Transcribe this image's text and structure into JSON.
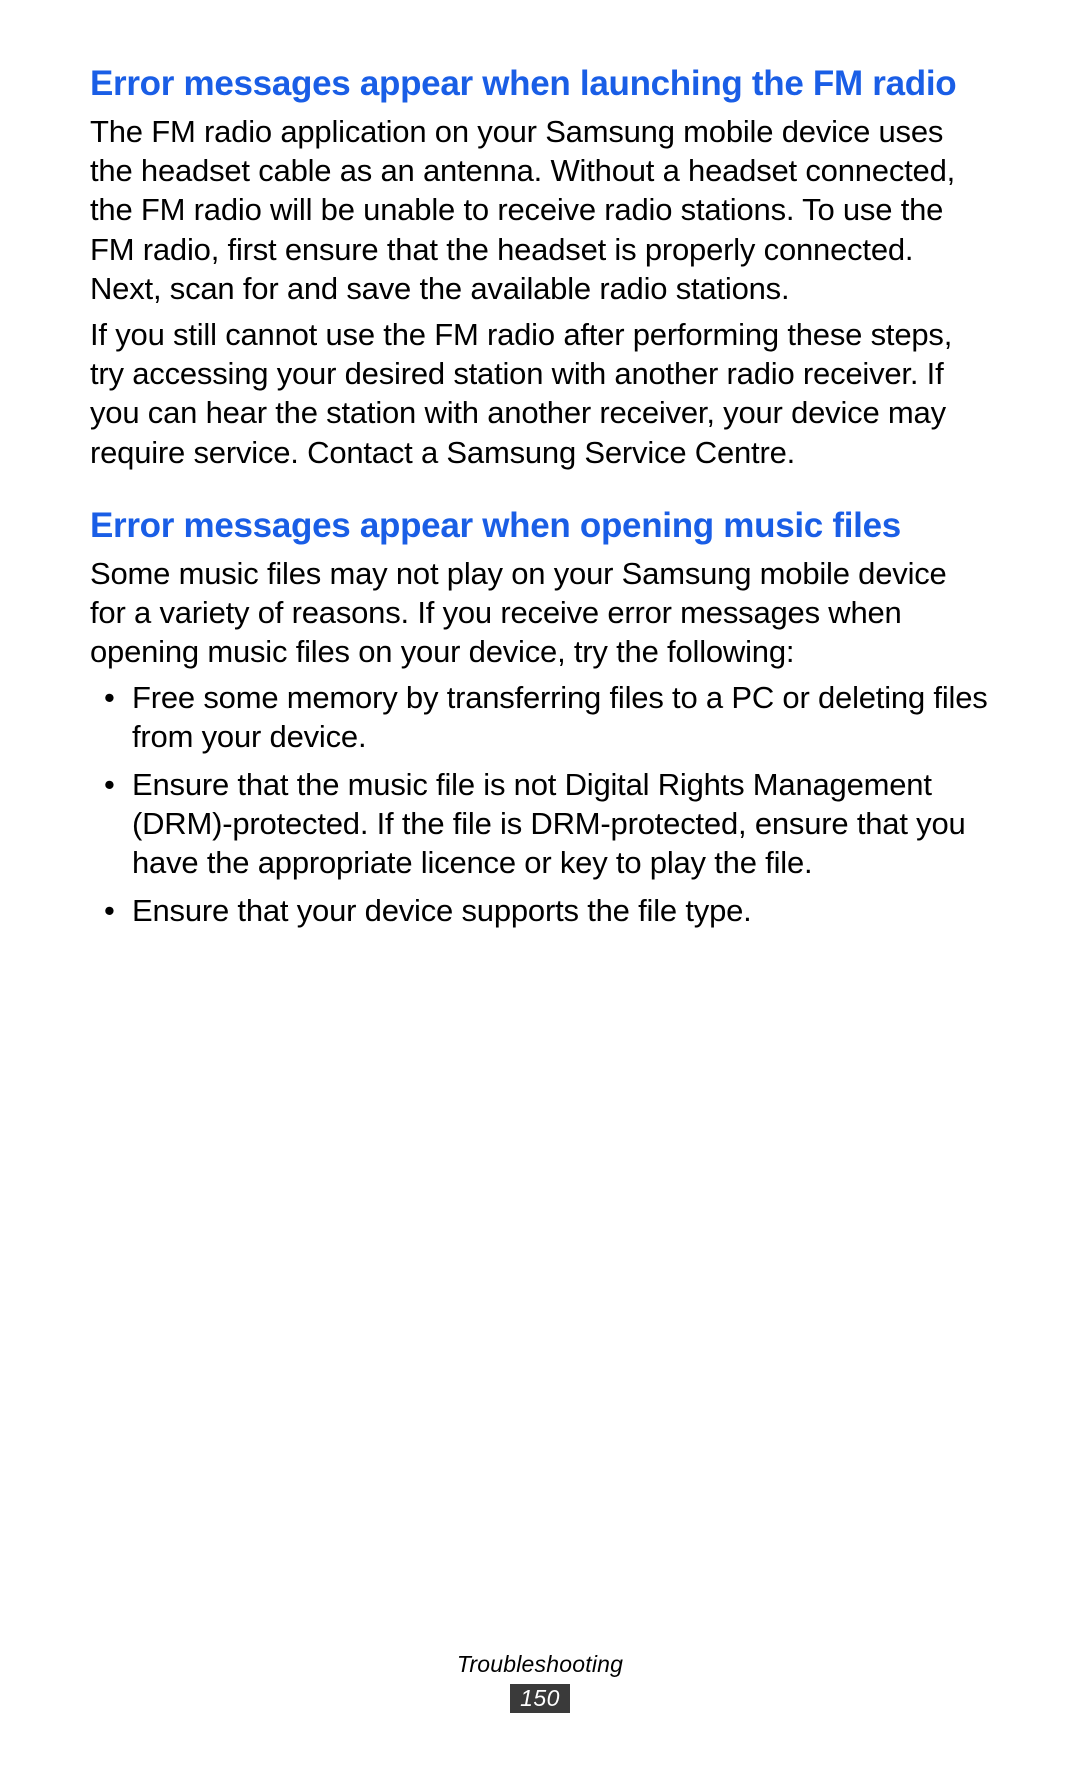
{
  "sections": {
    "fm_radio": {
      "heading": "Error messages appear when launching the FM radio",
      "para1": "The FM radio application on your Samsung mobile device uses the headset cable as an antenna. Without a headset connected, the FM radio will be unable to receive radio stations. To use the FM radio, first ensure that the headset is properly connected. Next, scan for and save the available radio stations.",
      "para2": "If you still cannot use the FM radio after performing these steps, try accessing your desired station with another radio receiver. If you can hear the station with another receiver, your device may require service. Contact a Samsung Service Centre."
    },
    "music_files": {
      "heading": "Error messages appear when opening music files",
      "para1": "Some music files may not play on your Samsung mobile device for a variety of reasons. If you receive error messages when opening music files on your device, try the following:",
      "bullets": {
        "b1": "Free some memory by transferring files to a PC or deleting files from your device.",
        "b2": "Ensure that the music file is not Digital Rights Management (DRM)-protected. If the file is DRM-protected, ensure that you have the appropriate licence or key to play the file.",
        "b3": "Ensure that your device supports the file type."
      }
    }
  },
  "footer": {
    "section_label": "Troubleshooting",
    "page_number": "150"
  }
}
